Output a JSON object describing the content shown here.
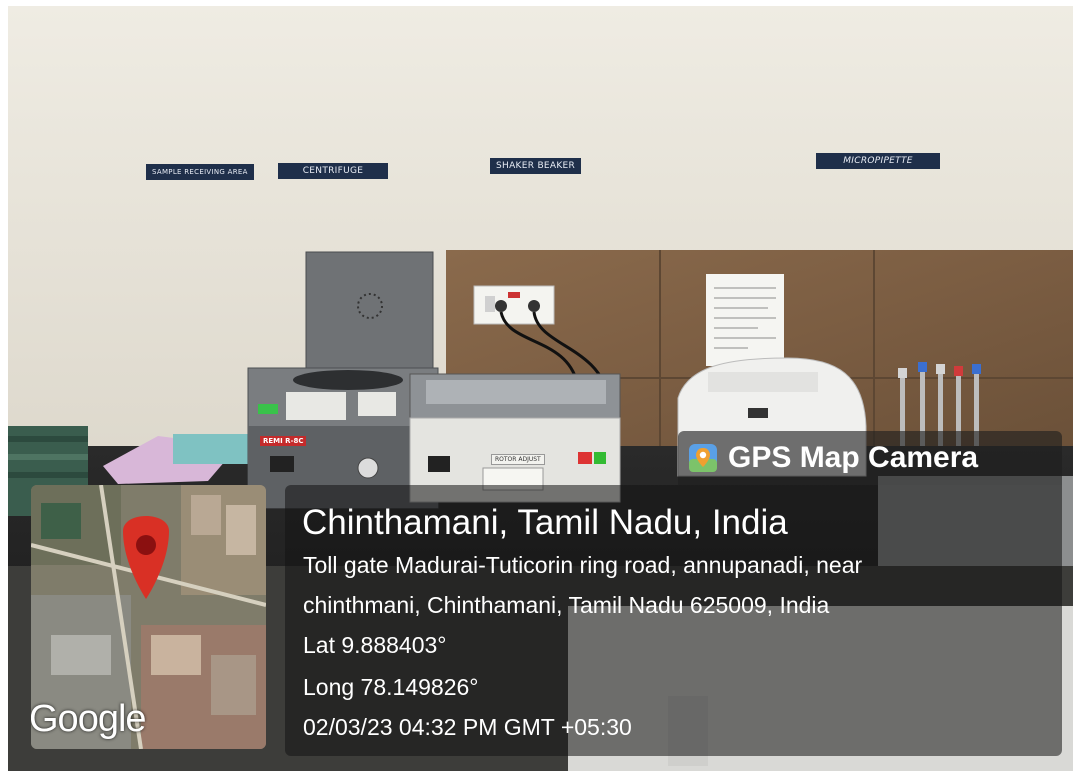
{
  "wall_labels": {
    "sample": "SAMPLE RECEIVING AREA",
    "centrifuge": "CENTRIFUGE",
    "shaker": "SHAKER BEAKER",
    "micropipette": "MICROPIPETTE"
  },
  "machine_labels": {
    "centrifuge_brand": "REMI R-8C",
    "shaker_plate": "ROTOR ADJUST"
  },
  "overlay": {
    "brand": "GPS Map Camera",
    "map_provider": "Google",
    "place": "Chinthamani, Tamil Nadu, India",
    "address_line1": "Toll gate Madurai-Tuticorin ring road, annupanadi, near",
    "address_line2": "chinthmani, Chinthamani, Tamil Nadu 625009, India",
    "lat": "Lat 9.888403°",
    "long": "Long 78.149826°",
    "datetime": "02/03/23 04:32 PM GMT +05:30"
  },
  "icons": {
    "brand_icon": "map-pin-camera-icon",
    "map_pin": "map-marker-icon"
  },
  "colors": {
    "pin": "#d93025",
    "overlay_bg": "#1e1e1e",
    "wall": "#e9e6dc",
    "label_bg": "#1f2f4a"
  }
}
